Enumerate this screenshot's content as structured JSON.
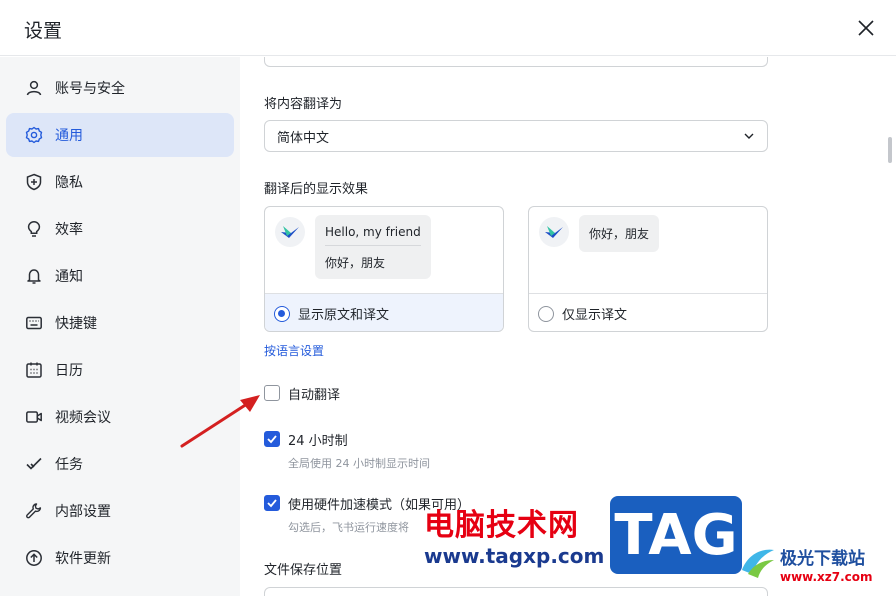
{
  "window": {
    "title": "设置"
  },
  "sidebar": {
    "items": [
      {
        "label": "账号与安全",
        "icon": "user-icon"
      },
      {
        "label": "通用",
        "icon": "gear-icon",
        "active": true
      },
      {
        "label": "隐私",
        "icon": "shield-icon"
      },
      {
        "label": "效率",
        "icon": "lightbulb-icon"
      },
      {
        "label": "通知",
        "icon": "bell-icon"
      },
      {
        "label": "快捷键",
        "icon": "keyboard-icon"
      },
      {
        "label": "日历",
        "icon": "calendar-icon"
      },
      {
        "label": "视频会议",
        "icon": "video-icon"
      },
      {
        "label": "任务",
        "icon": "task-check-icon"
      },
      {
        "label": "内部设置",
        "icon": "wrench-icon"
      },
      {
        "label": "软件更新",
        "icon": "upload-arrow-icon"
      }
    ]
  },
  "main": {
    "translate_to": {
      "label": "将内容翻译为",
      "value": "简体中文"
    },
    "display_effect": {
      "label": "翻译后的显示效果",
      "option_both": {
        "preview_original": "Hello, my friend",
        "preview_translated": "你好，朋友",
        "label": "显示原文和译文",
        "selected": true
      },
      "option_translated": {
        "preview_translated": "你好，朋友",
        "label": "仅显示译文",
        "selected": false
      }
    },
    "language_settings_link": "按语言设置",
    "auto_translate": {
      "label": "自动翻译",
      "checked": false
    },
    "clock_24h": {
      "label": "24 小时制",
      "desc": "全局使用 24 小时制显示时间",
      "checked": true
    },
    "hardware_accel": {
      "label": "使用硬件加速模式（如果可用）",
      "desc": "勾选后，飞书运行速度将",
      "checked": true
    },
    "file_location": {
      "label": "文件保存位置"
    }
  },
  "watermark": {
    "text_cn": "电脑技术网",
    "url": "www.tagxp.com",
    "tag": "TAG",
    "site_name": "极光下载站",
    "site_url": "www.xz7.com"
  },
  "colors": {
    "accent": "#245bdb",
    "active_bg": "#dde6f8",
    "sidebar_bg": "#f5f6f7"
  }
}
